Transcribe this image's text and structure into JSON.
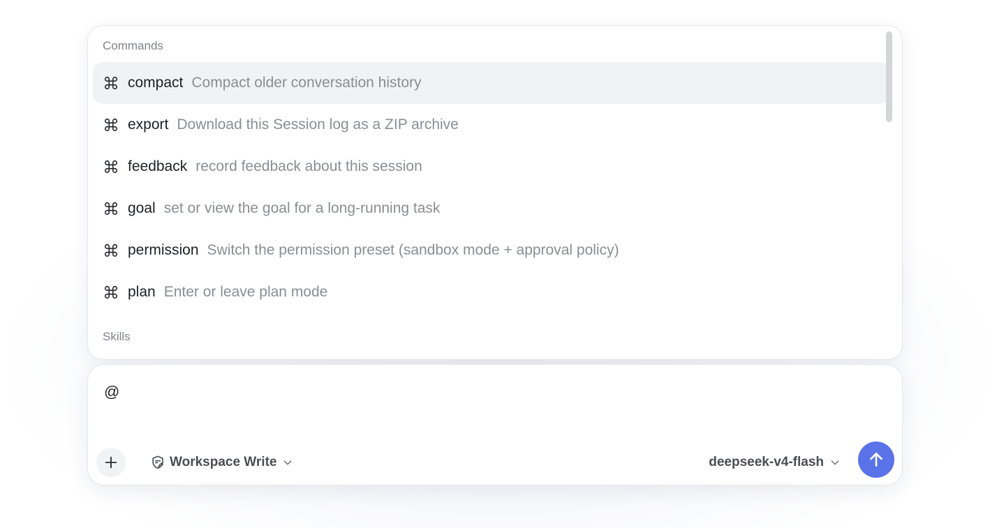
{
  "popup": {
    "commands_header": "Commands",
    "skills_header": "Skills",
    "commands": [
      {
        "name": "compact",
        "description": "Compact older conversation history",
        "icon": "command-icon",
        "active": true
      },
      {
        "name": "export",
        "description": "Download this Session log as a ZIP archive",
        "icon": "command-icon",
        "active": false
      },
      {
        "name": "feedback",
        "description": "record feedback about this session",
        "icon": "command-icon",
        "active": false
      },
      {
        "name": "goal",
        "description": "set or view the goal for a long-running task",
        "icon": "command-icon",
        "active": false
      },
      {
        "name": "permission",
        "description": "Switch the permission preset (sandbox mode + approval policy)",
        "icon": "command-icon",
        "active": false
      },
      {
        "name": "plan",
        "description": "Enter or leave plan mode",
        "icon": "command-icon",
        "active": false
      }
    ]
  },
  "composer": {
    "input_value": "@",
    "add_icon": "plus-icon",
    "permission": {
      "label": "Workspace Write",
      "icon": "shield-edit-icon"
    },
    "model": {
      "label": "deepseek-v4-flash"
    },
    "send_icon": "arrow-up-icon"
  },
  "colors": {
    "accent": "#5b73e8",
    "active_row": "#f1f2f4",
    "muted_text": "#8a8d93"
  }
}
